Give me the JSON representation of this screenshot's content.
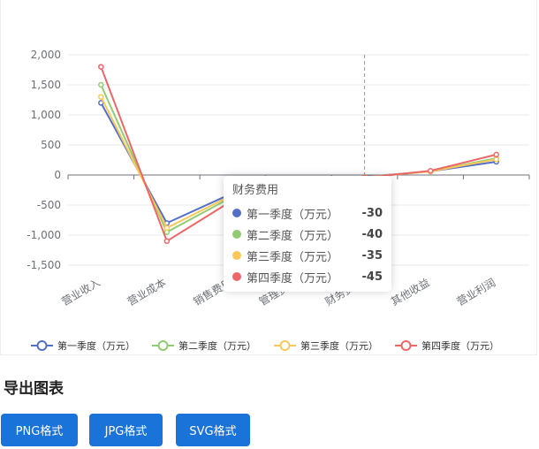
{
  "chart_data": {
    "type": "line",
    "categories": [
      "营业收入",
      "营业成本",
      "销售费用",
      "管理费用",
      "财务费用",
      "其他收益",
      "营业利润"
    ],
    "series": [
      {
        "name": "第一季度（万元）",
        "color": "#5470c6",
        "values": [
          1200,
          -800,
          -300,
          -100,
          -30,
          60,
          220
        ]
      },
      {
        "name": "第二季度（万元）",
        "color": "#91cc75",
        "values": [
          1500,
          -950,
          -360,
          -120,
          -40,
          60,
          280
        ]
      },
      {
        "name": "第三季度（万元）",
        "color": "#fac858",
        "values": [
          1300,
          -880,
          -330,
          -110,
          -35,
          60,
          260
        ]
      },
      {
        "name": "第四季度（万元）",
        "color": "#ee6666",
        "values": [
          1800,
          -1100,
          -420,
          -140,
          -45,
          70,
          340
        ]
      }
    ],
    "yticks": [
      2000,
      1500,
      1000,
      500,
      0,
      -500,
      -1000,
      -1500
    ],
    "ytick_labels": [
      "2,000",
      "1,500",
      "1,000",
      "500",
      "0",
      "-500",
      "-1,000",
      "-1,500"
    ],
    "ylim": [
      -1500,
      2000
    ],
    "legend_position": "bottom",
    "grid": true
  },
  "tooltip": {
    "title": "财务费用",
    "rows": [
      {
        "name": "第一季度（万元）",
        "value": "-30",
        "color": "#5470c6"
      },
      {
        "name": "第二季度（万元）",
        "value": "-40",
        "color": "#91cc75"
      },
      {
        "name": "第三季度（万元）",
        "value": "-35",
        "color": "#fac858"
      },
      {
        "name": "第四季度（万元）",
        "value": "-45",
        "color": "#ee6666"
      }
    ]
  },
  "export": {
    "title": "导出图表",
    "buttons": [
      {
        "label": "PNG格式"
      },
      {
        "label": "JPG格式"
      },
      {
        "label": "SVG格式"
      }
    ]
  }
}
